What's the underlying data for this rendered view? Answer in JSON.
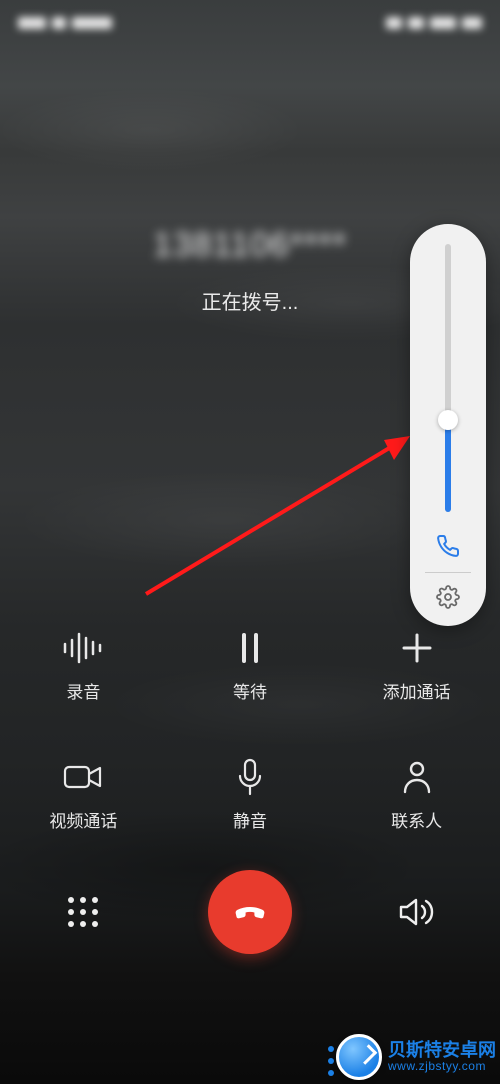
{
  "status_bar": {
    "left_placeholder": "........",
    "right_placeholder": "......"
  },
  "call": {
    "number_masked": "1381106****",
    "status_text": "正在拨号..."
  },
  "volume": {
    "level_percent": 34.5,
    "mode_icon": "phone-icon"
  },
  "actions": {
    "record": {
      "label": "录音",
      "icon": "waveform-icon"
    },
    "hold": {
      "label": "等待",
      "icon": "pause-icon"
    },
    "add": {
      "label": "添加通话",
      "icon": "plus-icon"
    },
    "video": {
      "label": "视频通话",
      "icon": "video-icon"
    },
    "mute": {
      "label": "静音",
      "icon": "mic-icon"
    },
    "contacts": {
      "label": "联系人",
      "icon": "person-icon"
    }
  },
  "bottom": {
    "dialpad_icon": "dialpad-icon",
    "endcall_icon": "phone-down-icon",
    "speaker_icon": "speaker-icon"
  },
  "watermark": {
    "name": "贝斯特安卓网",
    "url": "www.zjbstyy.com"
  },
  "colors": {
    "accent_blue": "#2b7de9",
    "end_red": "#e83b2d"
  }
}
